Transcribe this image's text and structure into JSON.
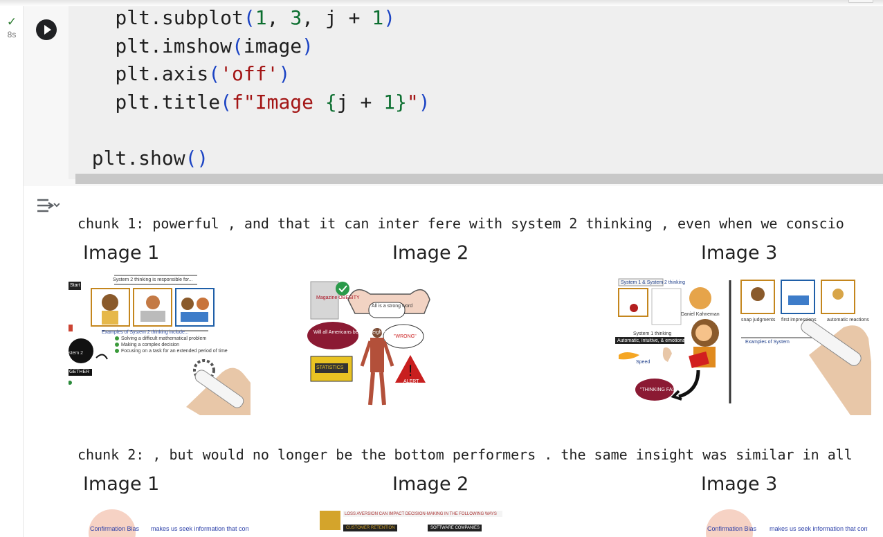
{
  "cell": {
    "status_icon": "check-icon",
    "exec_time": "8s",
    "code_lines": [
      [
        {
          "t": "    plt.subplot",
          "c": "fn"
        },
        {
          "t": "(",
          "c": "br"
        },
        {
          "t": "1",
          "c": "num"
        },
        {
          "t": ", ",
          "c": ""
        },
        {
          "t": "3",
          "c": "num"
        },
        {
          "t": ", j + ",
          "c": ""
        },
        {
          "t": "1",
          "c": "num"
        },
        {
          "t": ")",
          "c": "br"
        }
      ],
      [
        {
          "t": "    plt.imshow",
          "c": "fn"
        },
        {
          "t": "(",
          "c": "br"
        },
        {
          "t": "image",
          "c": ""
        },
        {
          "t": ")",
          "c": "br"
        }
      ],
      [
        {
          "t": "    plt.axis",
          "c": "fn"
        },
        {
          "t": "(",
          "c": "br"
        },
        {
          "t": "'off'",
          "c": "str"
        },
        {
          "t": ")",
          "c": "br"
        }
      ],
      [
        {
          "t": "    plt.title",
          "c": "fn"
        },
        {
          "t": "(",
          "c": "br"
        },
        {
          "t": "f\"Image ",
          "c": "str"
        },
        {
          "t": "{",
          "c": "num"
        },
        {
          "t": "j + ",
          "c": ""
        },
        {
          "t": "1",
          "c": "num"
        },
        {
          "t": "}",
          "c": "num"
        },
        {
          "t": "\"",
          "c": "str"
        },
        {
          "t": ")",
          "c": "br"
        }
      ],
      [],
      [
        {
          "t": "  plt.show",
          "c": "fn"
        },
        {
          "t": "()",
          "c": "br"
        }
      ]
    ]
  },
  "output": {
    "chunks": [
      {
        "text": "chunk 1: powerful , and that it can inter fere with system 2 thinking , even when we conscio",
        "images": [
          {
            "title": "Image 1",
            "labels": [
              "System 2 thinking is responsible for...",
              "Examples of System 2 thinking include...",
              "Solving a difficult mathematical problem",
              "Making a complex decision",
              "Focusing on a task for an extended period of time",
              "stem 2",
              "GETHER",
              "Start"
            ]
          },
          {
            "title": "Image 2",
            "labels": [
              "Magazine OBESITY",
              "All is a strong word",
              "Will all Americans be overweight?",
              "\"WRONG\"",
              "STATISTICS",
              "ALERT"
            ]
          },
          {
            "title": "Image 3",
            "labels": [
              "System 1 & System 2 thinking",
              "Daniel Kahneman",
              "snap judgments",
              "first impressions",
              "automatic reactions",
              "System 1 thinking",
              "Automatic, intuitive, & emotional",
              "Speed",
              "\"THINKING FAST\"",
              "Examples of System"
            ]
          }
        ]
      },
      {
        "text": "chunk 2: , but would no longer be the bottom performers . the same insight was similar in all",
        "images": [
          {
            "title": "Image 1",
            "labels": [
              "Confirmation Bias",
              "makes us seek information that confirms our beliefs"
            ]
          },
          {
            "title": "Image 2",
            "labels": [
              "LOSS AVERSION CAN IMPACT DECISION-MAKING IN THE FOLLOWING WAYS",
              "CUSTOMER RETENTION",
              "SOFTWARE COMPANIES"
            ]
          },
          {
            "title": "Image 3",
            "labels": [
              "Confirmation Bias",
              "makes us seek information that confirms our beliefs"
            ]
          }
        ]
      }
    ]
  }
}
